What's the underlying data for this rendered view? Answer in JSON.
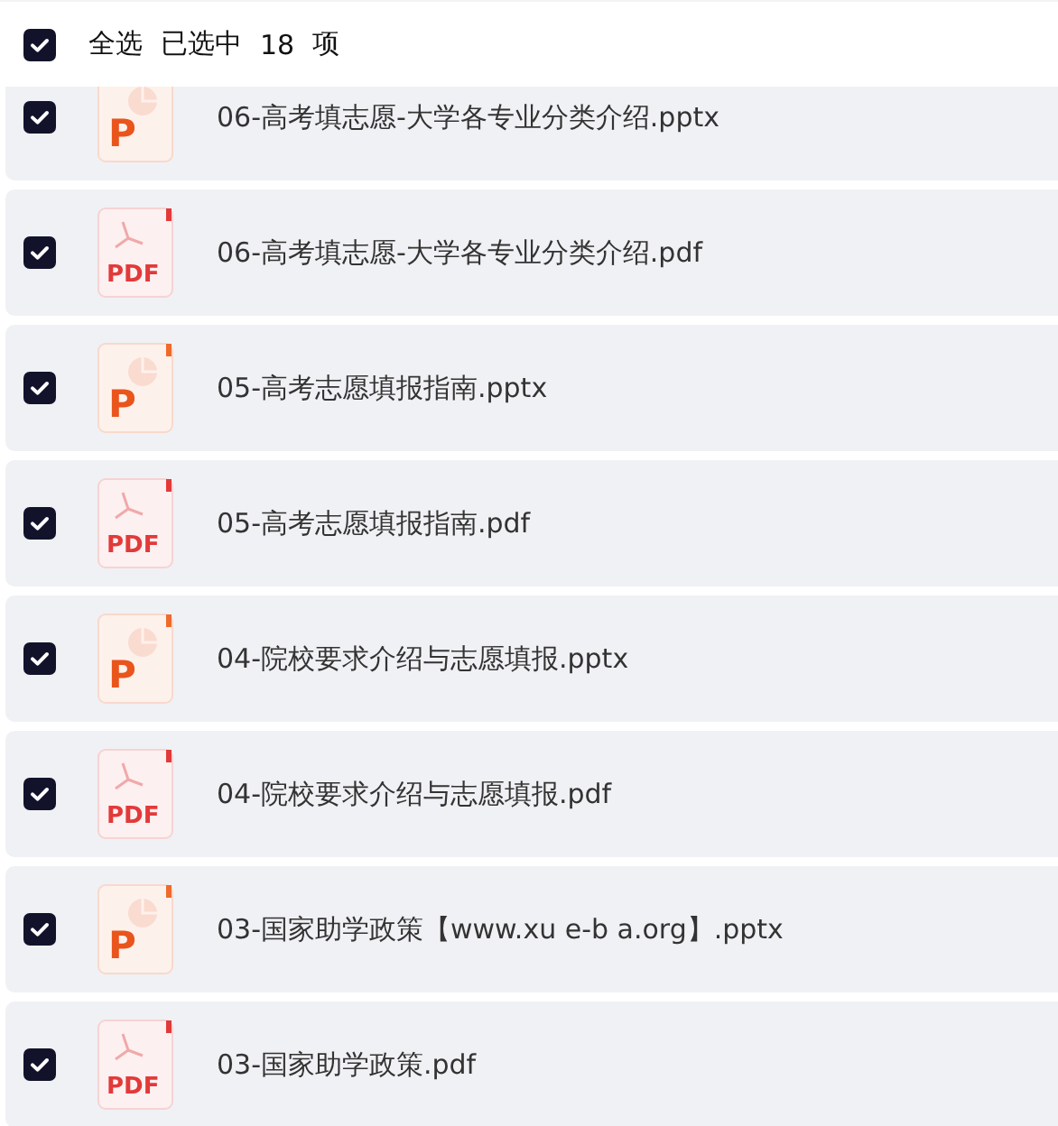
{
  "header": {
    "checked": true,
    "select_all": "全选",
    "selected_label": "已选中",
    "count": "18",
    "unit": "项"
  },
  "files": [
    {
      "name": "06-高考填志愿-大学各专业分类介绍.pptx",
      "kind": "pptx",
      "icon_text": "P",
      "checked": true
    },
    {
      "name": "06-高考填志愿-大学各专业分类介绍.pdf",
      "kind": "pdf",
      "icon_text": "PDF",
      "checked": true
    },
    {
      "name": "05-高考志愿填报指南.pptx",
      "kind": "pptx",
      "icon_text": "P",
      "checked": true
    },
    {
      "name": "05-高考志愿填报指南.pdf",
      "kind": "pdf",
      "icon_text": "PDF",
      "checked": true
    },
    {
      "name": "04-院校要求介绍与志愿填报.pptx",
      "kind": "pptx",
      "icon_text": "P",
      "checked": true
    },
    {
      "name": "04-院校要求介绍与志愿填报.pdf",
      "kind": "pdf",
      "icon_text": "PDF",
      "checked": true
    },
    {
      "name": "03-国家助学政策【www.xu e-b a.org】.pptx",
      "kind": "pptx",
      "icon_text": "P",
      "checked": true
    },
    {
      "name": "03-国家助学政策.pdf",
      "kind": "pdf",
      "icon_text": "PDF",
      "checked": true
    }
  ]
}
